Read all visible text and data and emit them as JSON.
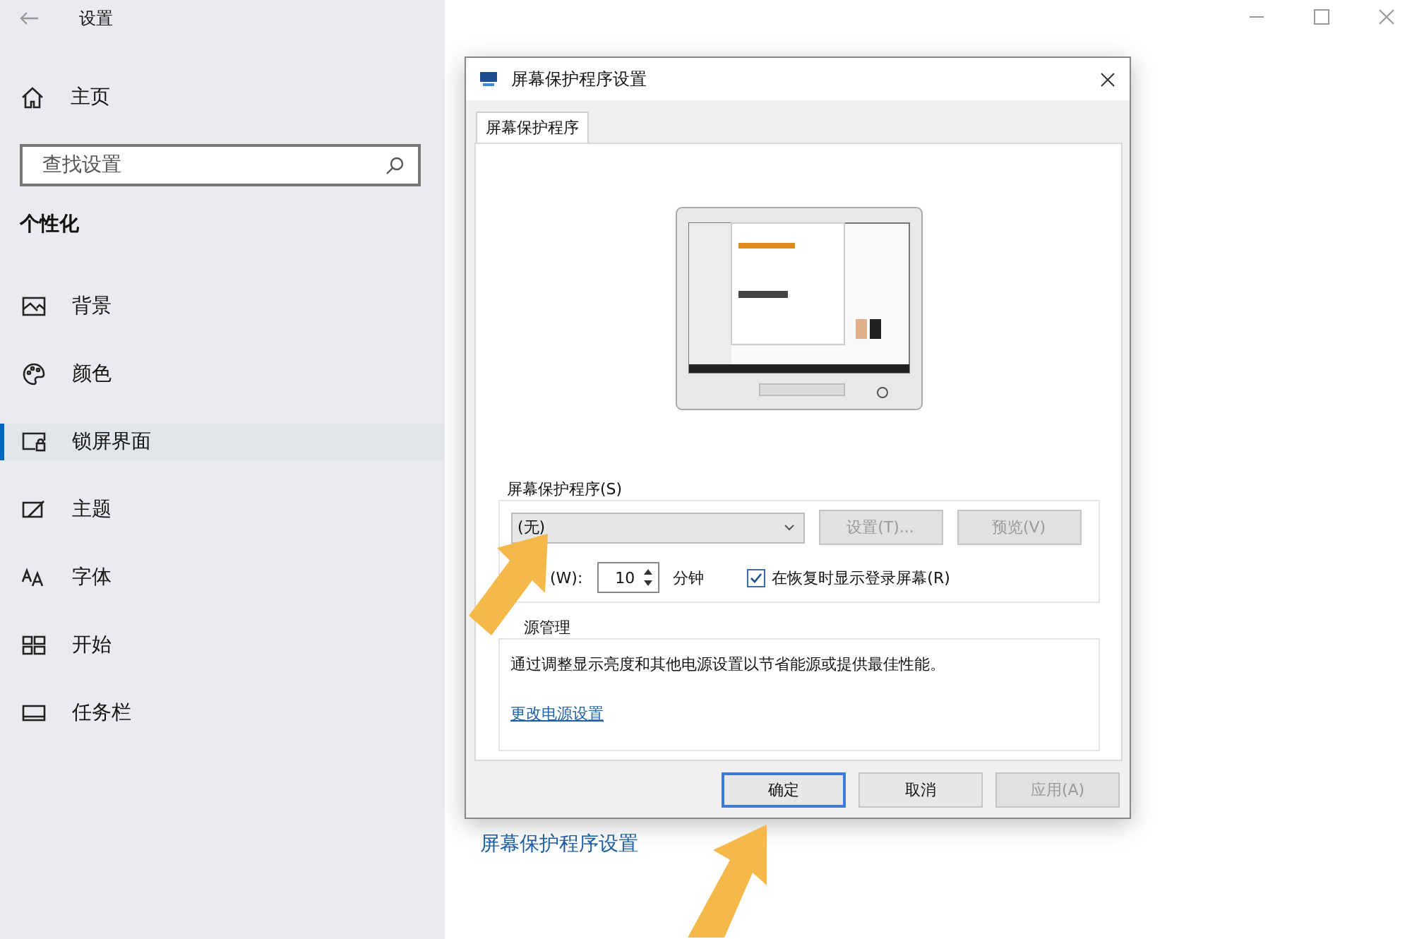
{
  "window": {
    "title": "设置"
  },
  "sidebar": {
    "home": "主页",
    "search": {
      "placeholder": "查找设置"
    },
    "section": "个性化",
    "items": [
      {
        "label": "背景",
        "kind": "picture",
        "selected": false
      },
      {
        "label": "颜色",
        "kind": "palette",
        "selected": false
      },
      {
        "label": "锁屏界面",
        "kind": "lockscreen",
        "selected": true
      },
      {
        "label": "主题",
        "kind": "theme",
        "selected": false
      },
      {
        "label": "字体",
        "kind": "font",
        "selected": false
      },
      {
        "label": "开始",
        "kind": "start",
        "selected": false
      },
      {
        "label": "任务栏",
        "kind": "taskbar",
        "selected": false
      }
    ]
  },
  "main": {
    "link": "屏幕保护程序设置"
  },
  "dialog": {
    "title": "屏幕保护程序设置",
    "tabs": [
      {
        "label": "屏幕保护程序",
        "selected": true
      }
    ],
    "screensaver_group": {
      "label": "屏幕保护程序(S)",
      "select": {
        "value": "(无)"
      },
      "buttons": [
        {
          "label": "设置(T)...",
          "disabled": true
        },
        {
          "label": "预览(V)",
          "disabled": true
        }
      ],
      "wait_label": "(W):",
      "wait_value": "10",
      "wait_unit": "分钟",
      "resume_checkbox": {
        "label": "在恢复时显示登录屏幕(R)",
        "checked": true
      }
    },
    "power_group": {
      "label": "源管理",
      "text": "通过调整显示亮度和其他电源设置以节省能源或提供最佳性能。",
      "link": "更改电源设置"
    },
    "buttons": [
      {
        "label": "确定",
        "disabled": false,
        "default": true
      },
      {
        "label": "取消",
        "disabled": false,
        "default": false
      },
      {
        "label": "应用(A)",
        "disabled": true,
        "default": false
      }
    ]
  }
}
